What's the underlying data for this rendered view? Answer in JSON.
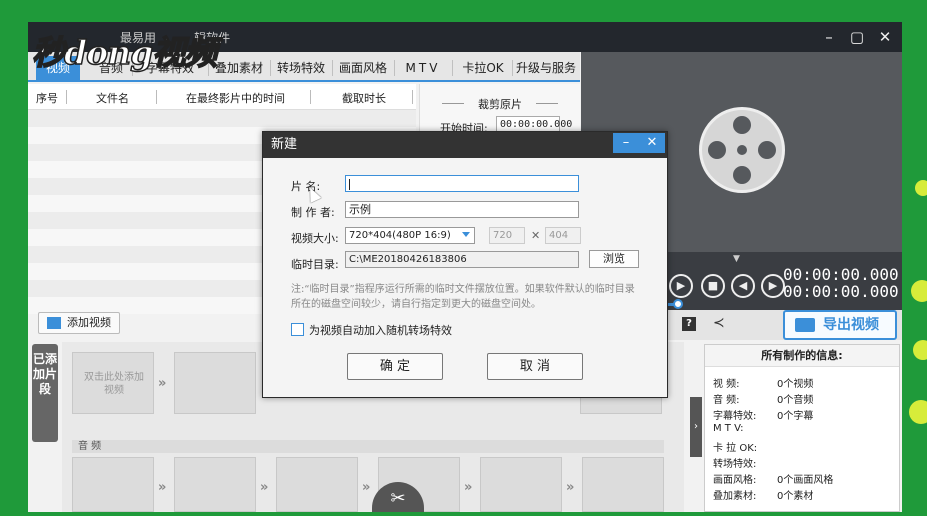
{
  "window": {
    "title": "辑软件",
    "brand_title": "最易用"
  },
  "watermark": "秒dong视频",
  "tabs": [
    {
      "label": "视频",
      "active": true
    },
    {
      "label": "音频"
    },
    {
      "label": "字幕特效"
    },
    {
      "label": "叠加素材"
    },
    {
      "label": "转场特效"
    },
    {
      "label": "画面风格"
    },
    {
      "label": "MTV"
    },
    {
      "label": "卡拉OK"
    },
    {
      "label": "升级与服务"
    }
  ],
  "table": {
    "columns": [
      "序号",
      "文件名",
      "在最终影片中的时间",
      "截取时长"
    ]
  },
  "crop": {
    "title": "裁剪原片",
    "start_label": "开始时间:",
    "start_value": "00:00:00.000"
  },
  "player": {
    "time_current": "00:00:00.000",
    "time_total": "00:00:00.000"
  },
  "export_label": "导出视频",
  "add_video_label": "添加视频",
  "side_label": "已添加片段",
  "timeline": {
    "placeholder": "双击此处添加视频",
    "audio_label": "音 频"
  },
  "info": {
    "title": "所有制作的信息:",
    "rows": [
      {
        "k": "视    频:",
        "v": "0个视频"
      },
      {
        "k": "音    频:",
        "v": "0个音频"
      },
      {
        "k": "字幕特效:",
        "v": "0个字幕"
      },
      {
        "k": "M  T  V:",
        "v": ""
      },
      {
        "k": "卡 拉 OK:",
        "v": ""
      },
      {
        "k": "转场特效:",
        "v": ""
      },
      {
        "k": "画面风格:",
        "v": "0个画面风格"
      },
      {
        "k": "叠加素材:",
        "v": "0个素材"
      }
    ]
  },
  "dialog": {
    "title": "新建",
    "name_label": "片    名:",
    "name_value": "",
    "author_label": "制 作 者:",
    "author_value": "示例",
    "size_label": "视频大小:",
    "size_value": "720*404(480P 16:9)",
    "width_value": "720",
    "height_value": "404",
    "dir_label": "临时目录:",
    "dir_value": "C:\\ME20180426183806",
    "browse_label": "浏览",
    "note": "注:“临时目录”指程序运行所需的临时文件摆放位置。如果软件默认的临时目录所在的磁盘空间较少，请自行指定到更大的磁盘空间处。",
    "checkbox_label": "为视频自动加入随机转场特效",
    "ok_label": "确  定",
    "cancel_label": "取  消"
  }
}
